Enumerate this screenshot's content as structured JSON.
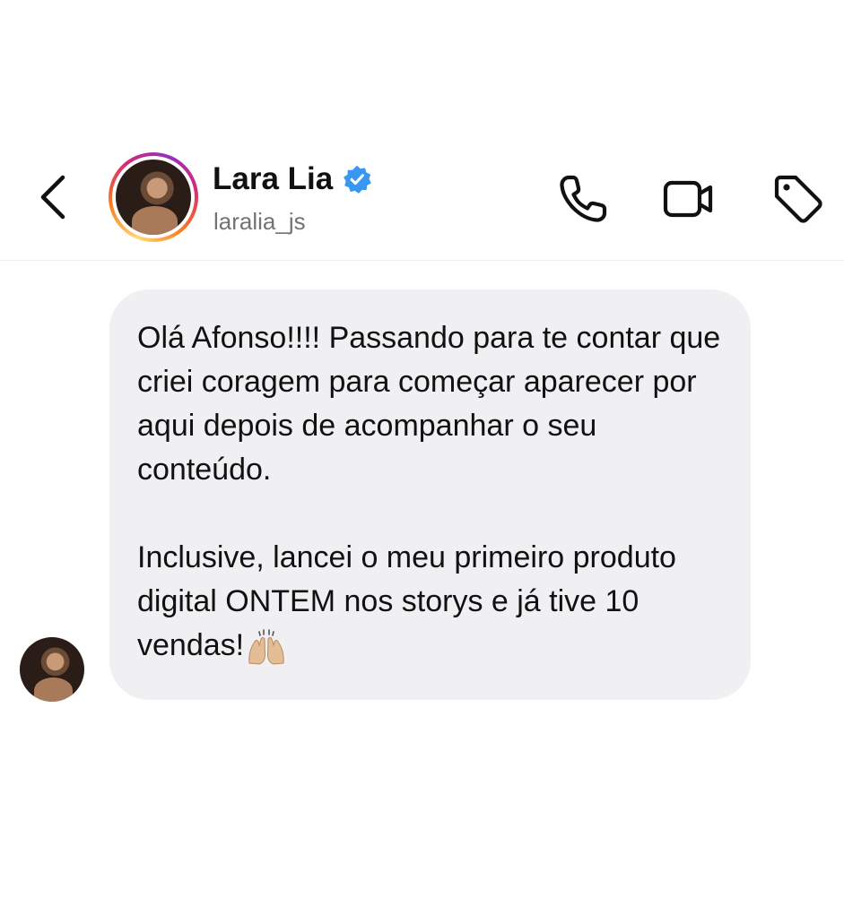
{
  "header": {
    "name": "Lara Lia",
    "handle": "laralia_js",
    "verified": true,
    "icons": {
      "back": "chevron-left-icon",
      "call": "phone-icon",
      "video": "video-camera-icon",
      "tag": "tag-icon",
      "verified": "verified-badge-icon"
    }
  },
  "conversation": {
    "messages": [
      {
        "sender": "Lara Lia",
        "paragraphs": [
          "Olá Afonso!!!! Passando para te contar que criei coragem para começar aparecer por aqui depois de acompanhar o seu conteúdo.",
          "Inclusive, lancei o meu primeiro produto digital ONTEM nos storys e já tive 10 vendas!"
        ],
        "emoji": "raising-hands-emoji"
      }
    ]
  },
  "colors": {
    "bubble": "#f0f0f3",
    "text": "#111111",
    "secondary_text": "#737373",
    "verified": "#3897f0"
  }
}
